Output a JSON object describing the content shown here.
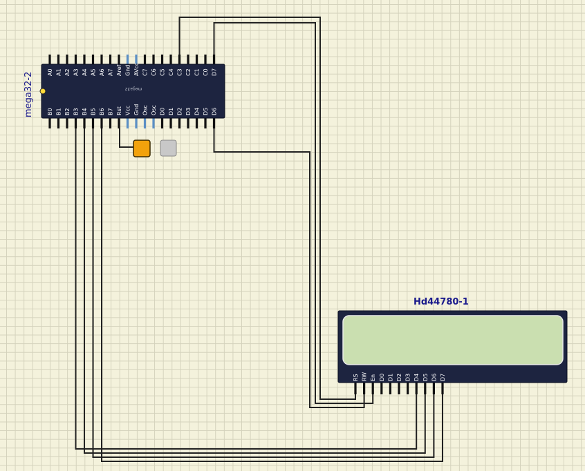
{
  "mcu": {
    "instance_label": "mega32-2",
    "part_marking": "mega32",
    "top_pins": [
      "A0",
      "A1",
      "A2",
      "A3",
      "A4",
      "A5",
      "A6",
      "A7",
      "Aref",
      "Gnd",
      "AVcc",
      "C7",
      "C6",
      "C5",
      "C4",
      "C3",
      "C2",
      "C1",
      "C0",
      "D7"
    ],
    "bottom_pins": [
      "B0",
      "B1",
      "B2",
      "B3",
      "B4",
      "B5",
      "B6",
      "B7",
      "Rst",
      "Vcc",
      "Gnd",
      "Osc",
      "Osc",
      "D0",
      "D1",
      "D2",
      "D3",
      "D4",
      "D5",
      "D6"
    ]
  },
  "lcd": {
    "instance_label": "Hd44780-1",
    "pins": [
      "RS",
      "RW",
      "En",
      "D0",
      "D1",
      "D2",
      "D3",
      "D4",
      "D5",
      "D6",
      "D7"
    ]
  },
  "colors": {
    "chip_body": "#1d2440",
    "power_pin": "#5b8fc4",
    "lcd_screen": "#cadfb0",
    "wire": "#222222",
    "reset_button": "#f2a20c",
    "toggle_button": "#c8c8c8"
  }
}
